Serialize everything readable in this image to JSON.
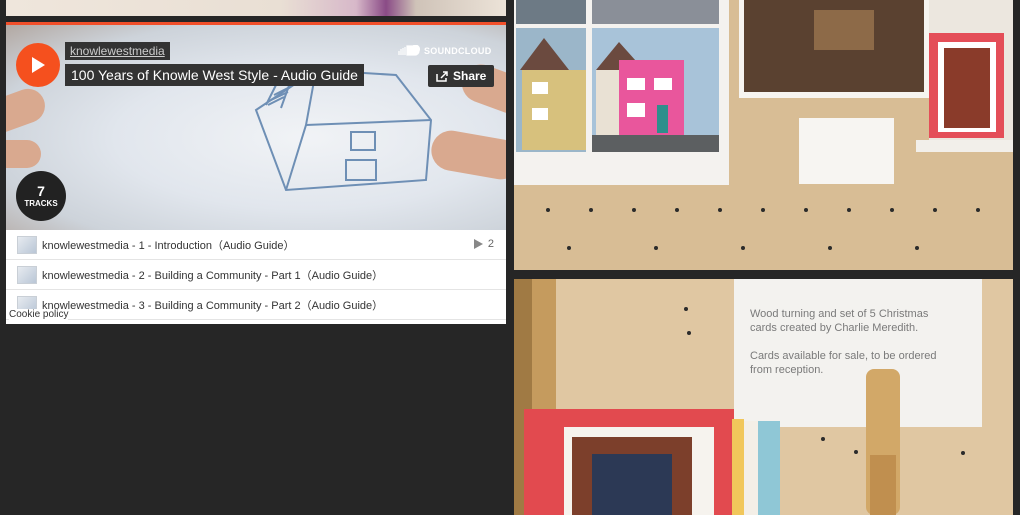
{
  "widget": {
    "username": "knowlewestmedia",
    "title": "100 Years of Knowle West Style - Audio Guide",
    "brand": "SOUNDCLOUD",
    "share_label": "Share",
    "track_count": "7",
    "tracks_label": "TRACKS",
    "tracks": [
      {
        "label": "knowlewestmedia - 1 - Introduction（Audio Guide）",
        "plays": "2"
      },
      {
        "label": "knowlewestmedia - 2 - Building a Community - Part 1（Audio Guide）"
      },
      {
        "label": "knowlewestmedia - 3 - Building a Community - Part 2（Audio Guide）"
      }
    ],
    "cookie_policy": "Cookie policy"
  },
  "photos": {
    "note_card_1": [
      "Wood turning and set of 5 Christmas",
      "cards created by Charlie Meredith.",
      "",
      "Cards available for sale, to be ordered",
      "from reception."
    ]
  },
  "colors": {
    "accent": "#f5501e",
    "background": "#262626"
  }
}
